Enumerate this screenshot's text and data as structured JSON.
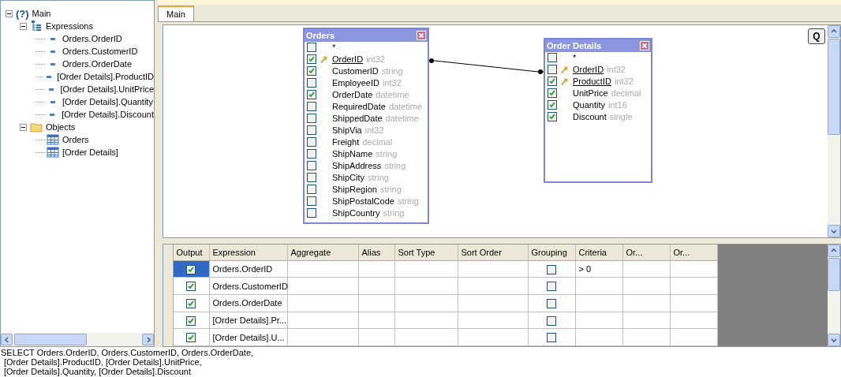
{
  "tree": [
    {
      "label": "Main",
      "kind": "query",
      "icon": "(?)",
      "expanded": true,
      "children": [
        {
          "label": "Expressions",
          "kind": "expressions",
          "expanded": true,
          "children": [
            {
              "label": "Orders.OrderID",
              "kind": "field"
            },
            {
              "label": "Orders.CustomerID",
              "kind": "field"
            },
            {
              "label": "Orders.OrderDate",
              "kind": "field"
            },
            {
              "label": "[Order Details].ProductID",
              "kind": "field"
            },
            {
              "label": "[Order Details].UnitPrice",
              "kind": "field"
            },
            {
              "label": "[Order Details].Quantity",
              "kind": "field"
            },
            {
              "label": "[Order Details].Discount",
              "kind": "field"
            }
          ]
        },
        {
          "label": "Objects",
          "kind": "folder",
          "expanded": true,
          "children": [
            {
              "label": "Orders",
              "kind": "table"
            },
            {
              "label": "[Order Details]",
              "kind": "table"
            }
          ]
        }
      ]
    }
  ],
  "tabs": [
    {
      "label": "Main",
      "selected": true
    }
  ],
  "diagram": {
    "q_button": "Q",
    "tables": [
      {
        "title": "Orders",
        "fields": [
          {
            "name": "*",
            "checked": false,
            "key": false
          },
          {
            "name": "OrderID",
            "type": "int32",
            "checked": true,
            "key": true
          },
          {
            "name": "CustomerID",
            "type": "string",
            "checked": true,
            "key": false
          },
          {
            "name": "EmployeeID",
            "type": "int32",
            "checked": false,
            "key": false
          },
          {
            "name": "OrderDate",
            "type": "datetime",
            "checked": true,
            "key": false
          },
          {
            "name": "RequiredDate",
            "type": "datetime",
            "checked": false,
            "key": false
          },
          {
            "name": "ShippedDate",
            "type": "datetime",
            "checked": false,
            "key": false
          },
          {
            "name": "ShipVia",
            "type": "int32",
            "checked": false,
            "key": false
          },
          {
            "name": "Freight",
            "type": "decimal",
            "checked": false,
            "key": false
          },
          {
            "name": "ShipName",
            "type": "string",
            "checked": false,
            "key": false
          },
          {
            "name": "ShipAddress",
            "type": "string",
            "checked": false,
            "key": false
          },
          {
            "name": "ShipCity",
            "type": "string",
            "checked": false,
            "key": false
          },
          {
            "name": "ShipRegion",
            "type": "string",
            "checked": false,
            "key": false
          },
          {
            "name": "ShipPostalCode",
            "type": "string",
            "checked": false,
            "key": false
          },
          {
            "name": "ShipCountry",
            "type": "string",
            "checked": false,
            "key": false
          }
        ]
      },
      {
        "title": "Order Details",
        "fields": [
          {
            "name": "*",
            "checked": false,
            "key": false
          },
          {
            "name": "OrderID",
            "type": "int32",
            "checked": false,
            "key": true
          },
          {
            "name": "ProductID",
            "type": "int32",
            "checked": true,
            "key": true
          },
          {
            "name": "UnitPrice",
            "type": "decimal",
            "checked": true,
            "key": false
          },
          {
            "name": "Quantity",
            "type": "int16",
            "checked": true,
            "key": false
          },
          {
            "name": "Discount",
            "type": "single",
            "checked": true,
            "key": false
          }
        ]
      }
    ]
  },
  "grid": {
    "columns": [
      "Output",
      "Expression",
      "Aggregate",
      "Alias",
      "Sort Type",
      "Sort Order",
      "Grouping",
      "Criteria",
      "Or...",
      "Or..."
    ],
    "rows": [
      {
        "output": true,
        "expression": "Orders.OrderID",
        "grouping": false,
        "criteria": "> 0",
        "selected": true
      },
      {
        "output": true,
        "expression": "Orders.CustomerID",
        "grouping": false,
        "selected": false
      },
      {
        "output": true,
        "expression": "Orders.OrderDate",
        "grouping": false,
        "selected": false
      },
      {
        "output": true,
        "expression": "[Order Details].Pr...",
        "grouping": false,
        "selected": false
      },
      {
        "output": true,
        "expression": "[Order Details].U...",
        "grouping": false,
        "selected": false
      }
    ]
  },
  "sql": [
    "SELECT Orders.OrderID, Orders.CustomerID, Orders.OrderDate,",
    "[Order Details].ProductID, [Order Details].UnitPrice,",
    "[Order Details].Quantity, [Order Details].Discount"
  ]
}
